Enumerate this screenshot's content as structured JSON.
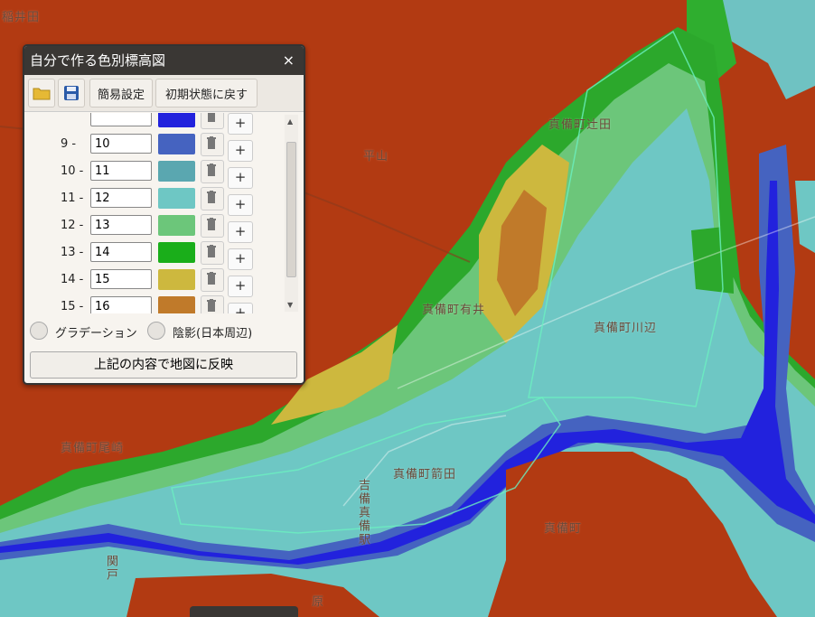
{
  "map": {
    "labels": [
      "稲井田",
      "平山",
      "真備町辻田",
      "真備町有井",
      "真備町川辺",
      "真備町尾崎",
      "真備町箭田",
      "真備町",
      "吉備真備駅",
      "関戸",
      "原"
    ]
  },
  "panel": {
    "title": "自分で作る色別標高図",
    "close": "×",
    "toolbar": {
      "open_icon": "folder-icon",
      "save_icon": "save-icon",
      "simple": "簡易設定",
      "reset": "初期状態に戻す"
    },
    "rows": [
      {
        "from": "",
        "to": "",
        "color": "#2222dd"
      },
      {
        "from": "9",
        "to": "10",
        "color": "#4563c0"
      },
      {
        "from": "10",
        "to": "11",
        "color": "#5aa7b0"
      },
      {
        "from": "11",
        "to": "12",
        "color": "#6ec7c4"
      },
      {
        "from": "12",
        "to": "13",
        "color": "#6cc67a"
      },
      {
        "from": "13",
        "to": "14",
        "color": "#1aae1a"
      },
      {
        "from": "14",
        "to": "15",
        "color": "#cdb83e"
      },
      {
        "from": "15",
        "to": "16",
        "color": "#c07a2a"
      }
    ],
    "sep": "-",
    "add": "+",
    "gradation": "グラデーション",
    "shade": "陰影(日本周辺)",
    "apply": "上記の内容で地図に反映"
  }
}
